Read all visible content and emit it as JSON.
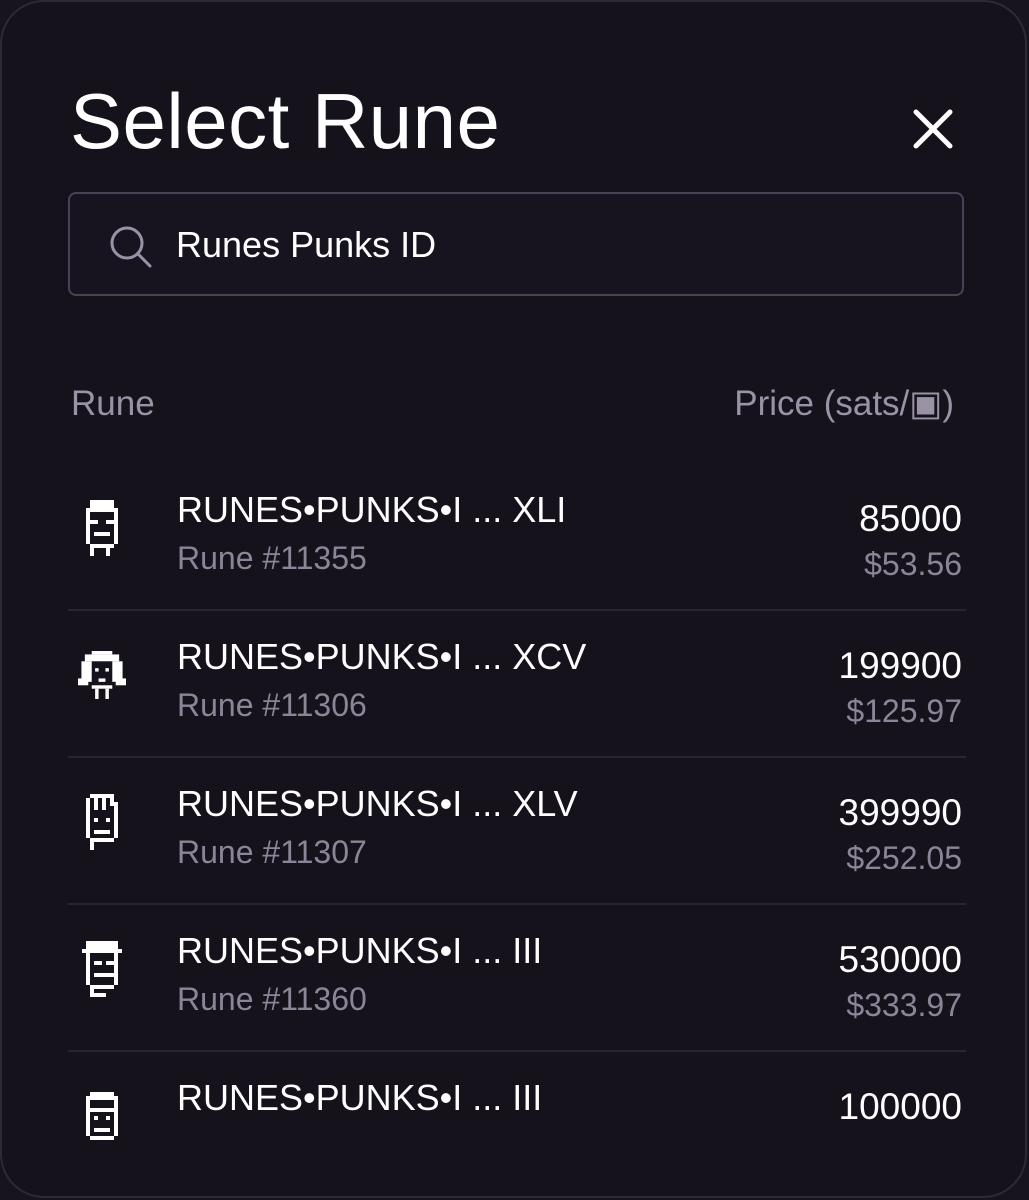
{
  "modal": {
    "title": "Select Rune",
    "close_icon": "close-icon"
  },
  "search": {
    "icon": "search-icon",
    "value": "Runes Punks ID",
    "placeholder": ""
  },
  "table": {
    "headers": {
      "rune": "Rune",
      "price": "Price (sats/▣)"
    },
    "rows": [
      {
        "name": "RUNES•PUNKS•I ... XLI",
        "number": "Rune #11355",
        "sats": "85000",
        "usd": "$53.56",
        "avatar": "punk-avatar-icon"
      },
      {
        "name": "RUNES•PUNKS•I ... XCV",
        "number": "Rune #11306",
        "sats": "199900",
        "usd": "$125.97",
        "avatar": "punk-avatar-icon"
      },
      {
        "name": "RUNES•PUNKS•I ... XLV",
        "number": "Rune #11307",
        "sats": "399990",
        "usd": "$252.05",
        "avatar": "punk-avatar-icon"
      },
      {
        "name": "RUNES•PUNKS•I ... III",
        "number": "Rune #11360",
        "sats": "530000",
        "usd": "$333.97",
        "avatar": "punk-avatar-icon"
      },
      {
        "name": "RUNES•PUNKS•I ... III",
        "number": "",
        "sats": "100000",
        "usd": "",
        "avatar": "punk-avatar-icon"
      }
    ]
  },
  "colors": {
    "background": "#15121c",
    "border": "#4a4157",
    "text_primary": "#ffffff",
    "text_secondary": "#8c8598"
  }
}
